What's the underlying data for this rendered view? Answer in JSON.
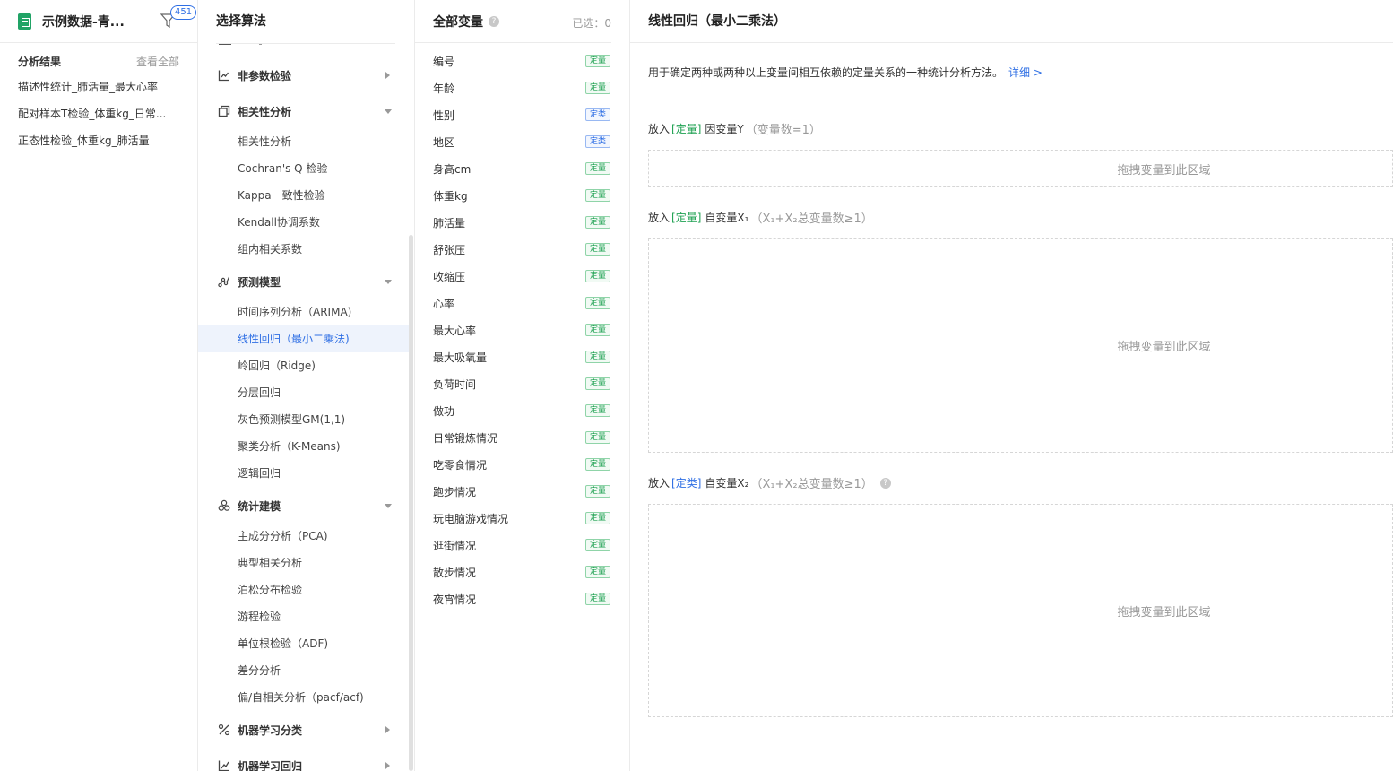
{
  "sidebar": {
    "doc_title": "示例数据-青...",
    "badge_count": "451",
    "results_title": "分析结果",
    "view_all": "查看全部",
    "results": [
      "描述性统计_肺活量_最大心率",
      "配对样本T检验_体重kg_日常...",
      "正态性检验_体重kg_肺活量"
    ]
  },
  "algorithms": {
    "title": "选择算法",
    "categories": {
      "nonparam": {
        "label": "非参数检验",
        "icon": "chart-box-icon",
        "state": "collapsed"
      },
      "correlation": {
        "label": "相关性分析",
        "icon": "copy-squares-icon",
        "state": "expanded"
      },
      "predict": {
        "label": "预测模型",
        "icon": "trend-nodes-icon",
        "state": "expanded"
      },
      "stats_model": {
        "label": "统计建模",
        "icon": "three-circles-icon",
        "state": "expanded"
      },
      "ml_class": {
        "label": "机器学习分类",
        "icon": "percent-icon",
        "state": "collapsed"
      },
      "ml_reg": {
        "label": "机器学习回归",
        "icon": "line-chart-icon",
        "state": "collapsed"
      }
    },
    "items": {
      "correlation": [
        "相关性分析",
        "Cochran's Q 检验",
        "Kappa一致性检验",
        "Kendall协调系数",
        "组内相关系数"
      ],
      "predict": [
        "时间序列分析（ARIMA)",
        "线性回归（最小二乘法)",
        "岭回归（Ridge)",
        "分层回归",
        "灰色预测模型GM(1,1)",
        "聚类分析（K-Means)",
        "逻辑回归"
      ],
      "stats_model": [
        "主成分分析（PCA)",
        "典型相关分析",
        "泊松分布检验",
        "游程检验",
        "单位根检验（ADF)",
        "差分分析",
        "偏/自相关分析（pacf/acf)"
      ]
    },
    "active_item": "线性回归（最小二乘法)"
  },
  "variables": {
    "title": "全部变量",
    "selected": "已选：0",
    "tag_quant": "定量",
    "tag_cat": "定类",
    "list": [
      {
        "name": "编号",
        "tag": "定量"
      },
      {
        "name": "年龄",
        "tag": "定量"
      },
      {
        "name": "性别",
        "tag": "定类"
      },
      {
        "name": "地区",
        "tag": "定类"
      },
      {
        "name": "身高cm",
        "tag": "定量"
      },
      {
        "name": "体重kg",
        "tag": "定量"
      },
      {
        "name": "肺活量",
        "tag": "定量"
      },
      {
        "name": "舒张压",
        "tag": "定量"
      },
      {
        "name": "收缩压",
        "tag": "定量"
      },
      {
        "name": "心率",
        "tag": "定量"
      },
      {
        "name": "最大心率",
        "tag": "定量"
      },
      {
        "name": "最大吸氧量",
        "tag": "定量"
      },
      {
        "name": "负荷时间",
        "tag": "定量"
      },
      {
        "name": "做功",
        "tag": "定量"
      },
      {
        "name": "日常锻炼情况",
        "tag": "定量"
      },
      {
        "name": "吃零食情况",
        "tag": "定量"
      },
      {
        "name": "跑步情况",
        "tag": "定量"
      },
      {
        "name": "玩电脑游戏情况",
        "tag": "定量"
      },
      {
        "name": "逛街情况",
        "tag": "定量"
      },
      {
        "name": "散步情况",
        "tag": "定量"
      },
      {
        "name": "夜宵情况",
        "tag": "定量"
      }
    ]
  },
  "main": {
    "title": "线性回归（最小二乘法）",
    "description": "用于确定两种或两种以上变量间相互依赖的定量关系的一种统计分析方法。",
    "detail_link": "详细 >",
    "drop_text": "拖拽变量到此区域",
    "zones": {
      "y": {
        "prefix": "放入",
        "kw": "[定量]",
        "name": "因变量Y",
        "hint": "（变量数=1）"
      },
      "x1": {
        "prefix": "放入",
        "kw": "[定量]",
        "name": "自变量X₁",
        "hint": "（X₁+X₂总变量数≥1）"
      },
      "x2": {
        "prefix": "放入",
        "kw": "[定类]",
        "name": "自变量X₂",
        "hint": "（X₁+X₂总变量数≥1）"
      }
    }
  },
  "colors": {
    "accent": "#2f6fe4",
    "quant": "#1fa152",
    "sheet": "#21a366"
  }
}
